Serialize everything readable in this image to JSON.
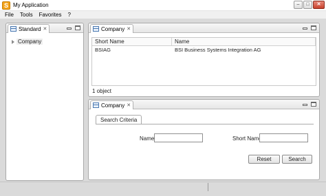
{
  "window": {
    "title": "My Application",
    "app_icon_letter": "S",
    "controls": {
      "minimize": "–",
      "maximize": "□",
      "close": "✕"
    }
  },
  "menu": [
    "File",
    "Tools",
    "Favorites",
    "?"
  ],
  "left_view": {
    "tab_label": "Standard",
    "tree": [
      {
        "label": "Company",
        "icon": "tree-expand-icon"
      }
    ]
  },
  "top_view": {
    "tab_label": "Company",
    "table": {
      "columns": [
        "Short Name",
        "Name"
      ],
      "rows": [
        [
          "BSIAG",
          "BSI Business Systems Integration AG"
        ]
      ]
    },
    "status": "1 object"
  },
  "bottom_view": {
    "tab_label": "Company",
    "subtab_label": "Search Criteria",
    "fields": {
      "name_label": "Name",
      "name_value": "",
      "short_name_label": "Short Name",
      "short_name_value": ""
    },
    "buttons": {
      "reset": "Reset",
      "search": "Search"
    }
  },
  "colors": {
    "app_icon": "#f4a41c",
    "close_button": "#c7412c",
    "workbench_bg": "#dadada"
  }
}
